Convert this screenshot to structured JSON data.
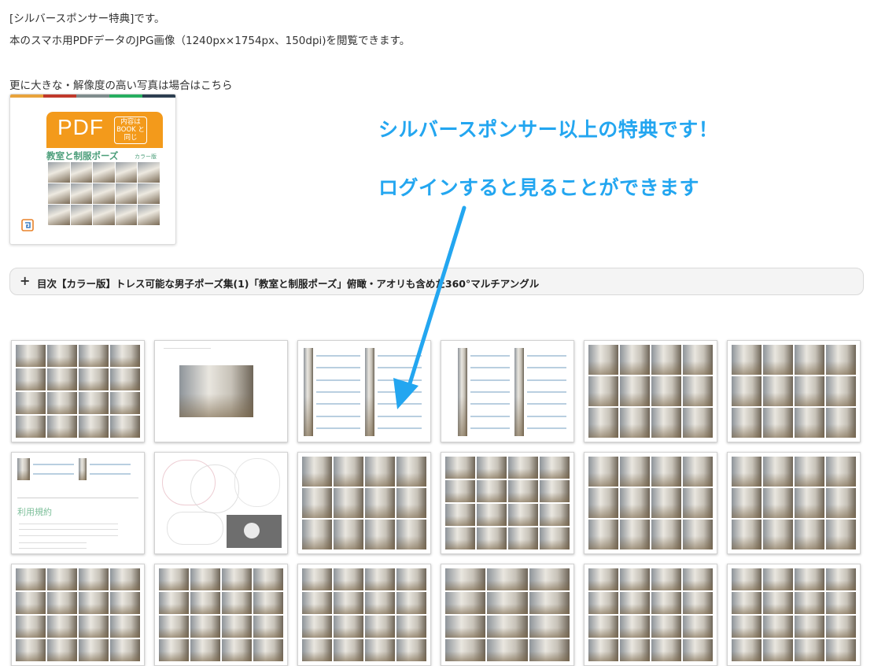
{
  "intro": {
    "line1": "[シルバースポンサー特典]です。",
    "line2": "本のスマホ用PDFデータのJPG画像（1240px×1754px、150dpi)を閲覧できます。",
    "line3": "更に大きな・解像度の高い写真は場合はこちら"
  },
  "card": {
    "pdf_label": "PDF",
    "badge": "内容は BOOK と 同じ",
    "cover_title": "教室と制服ポーズ",
    "cover_edition": "カラー版",
    "accent_colors": [
      "#e8a33c",
      "#c0392b",
      "#7f8c8d",
      "#27ae60",
      "#2c3e50"
    ]
  },
  "promo": {
    "line1": "シルバースポンサー以上の特典です！",
    "line2": "ログインすると見ることができます",
    "color": "#23a6f0"
  },
  "toc": {
    "icon": "plus-icon",
    "label": "目次【カラー版】トレス可能な男子ポーズ集(1)「教室と制服ポーズ」俯瞰・アオリも含めた360°マルチアングル"
  },
  "terms": {
    "title": "利用規約"
  }
}
